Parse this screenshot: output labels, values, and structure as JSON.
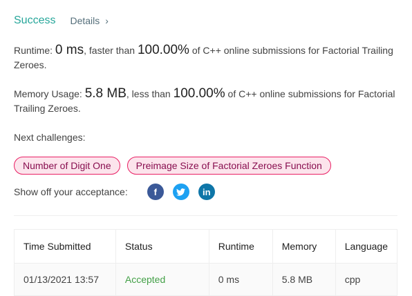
{
  "header": {
    "status": "Success",
    "details_label": "Details",
    "chevron": "›"
  },
  "runtime": {
    "label": "Runtime:",
    "value": "0 ms",
    "middle": ", faster than",
    "percent": "100.00%",
    "suffix": "of C++ online submissions for Factorial Trailing Zeroes."
  },
  "memory": {
    "label": "Memory Usage:",
    "value": "5.8 MB",
    "middle": ", less than",
    "percent": "100.00%",
    "suffix": "of C++ online submissions for Factorial Trailing Zeroes."
  },
  "next": {
    "label": "Next challenges:",
    "challenges": [
      "Number of Digit One",
      "Preimage Size of Factorial Zeroes Function"
    ]
  },
  "share": {
    "label": "Show off your acceptance:",
    "icons": [
      "facebook-icon",
      "twitter-icon",
      "linkedin-icon"
    ],
    "glyphs": [
      "f",
      "t",
      "in"
    ]
  },
  "table": {
    "columns": [
      "Time Submitted",
      "Status",
      "Runtime",
      "Memory",
      "Language"
    ],
    "rows": [
      {
        "time": "01/13/2021 13:57",
        "status": "Accepted",
        "runtime": "0 ms",
        "memory": "5.8 MB",
        "language": "cpp"
      }
    ]
  },
  "colors": {
    "success": "#26a69a",
    "pill_border": "#e91e63",
    "pill_bg": "#fce4ec",
    "pill_text": "#880e4f",
    "accepted": "#43a047",
    "facebook": "#3b5998",
    "twitter": "#1da1f2",
    "linkedin": "#0e76a8"
  }
}
